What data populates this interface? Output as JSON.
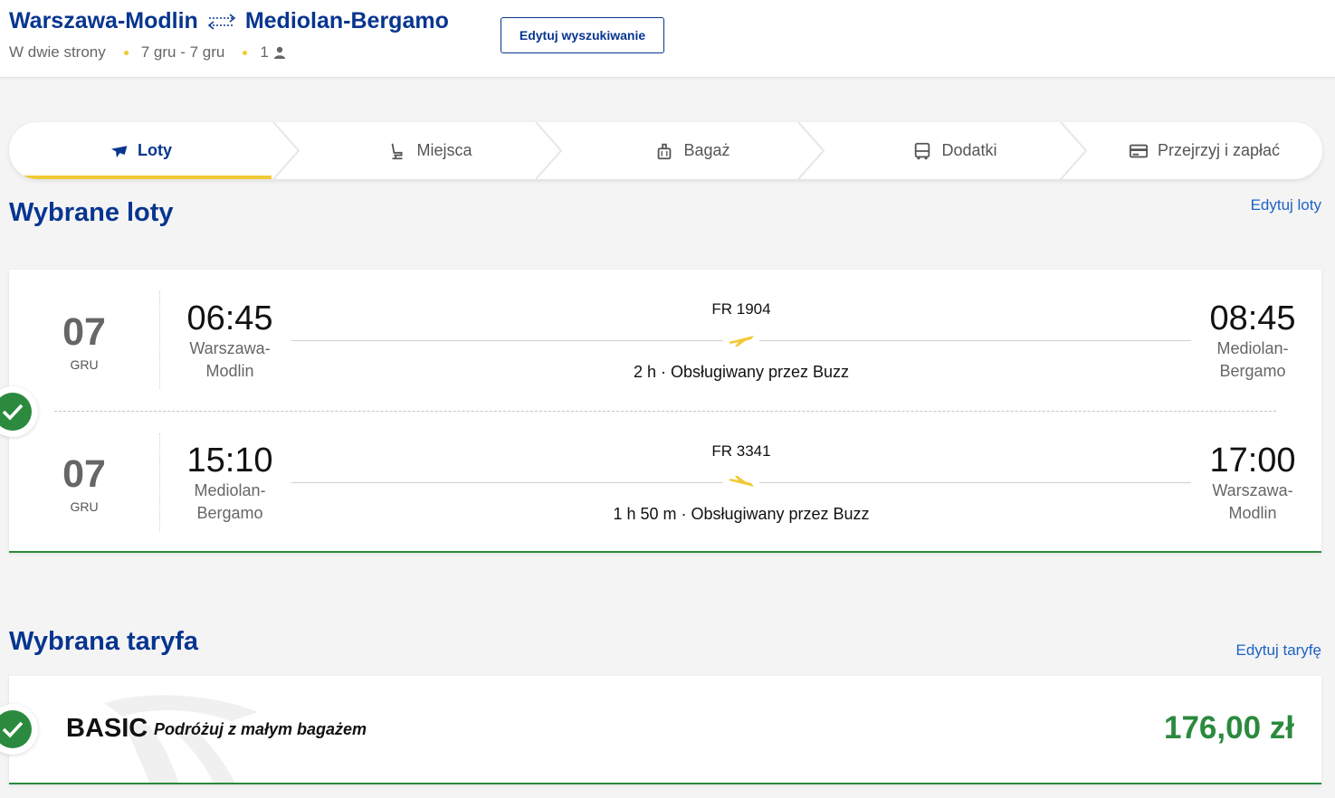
{
  "header": {
    "origin": "Warszawa-Modlin",
    "destination": "Mediolan-Bergamo",
    "trip_type": "W dwie strony",
    "dates": "7 gru - 7 gru",
    "passengers": "1",
    "edit_search_label": "Edytuj wyszukiwanie"
  },
  "stepper": {
    "steps": [
      {
        "label": "Loty",
        "icon": "plane-icon",
        "active": true
      },
      {
        "label": "Miejsca",
        "icon": "seat-icon",
        "active": false
      },
      {
        "label": "Bagaż",
        "icon": "luggage-icon",
        "active": false
      },
      {
        "label": "Dodatki",
        "icon": "bus-icon",
        "active": false
      },
      {
        "label": "Przejrzyj i zapłać",
        "icon": "credit-card-icon",
        "active": false
      }
    ]
  },
  "flights_section": {
    "title": "Wybrane loty",
    "edit_label": "Edytuj loty",
    "flights": [
      {
        "day": "07",
        "month": "GRU",
        "dep_time": "06:45",
        "dep_city": "Warszawa-Modlin",
        "flight_number": "FR 1904",
        "info": "2 h · Obsługiwany przez Buzz",
        "arr_time": "08:45",
        "arr_city": "Mediolan-Bergamo"
      },
      {
        "day": "07",
        "month": "GRU",
        "dep_time": "15:10",
        "dep_city": "Mediolan-Bergamo",
        "flight_number": "FR 3341",
        "info": "1 h 50 m · Obsługiwany przez Buzz",
        "arr_time": "17:00",
        "arr_city": "Warszawa-Modlin"
      }
    ]
  },
  "fare_section": {
    "title": "Wybrana taryfa",
    "edit_label": "Edytuj taryfę",
    "fare_name": "BASIC",
    "fare_description": "Podróżuj z małym bagażem",
    "price": "176,00 zł"
  },
  "colors": {
    "brand_blue": "#073590",
    "accent_yellow": "#f1c933",
    "success_green": "#2b8a3e",
    "link_blue": "#1f62c4"
  }
}
